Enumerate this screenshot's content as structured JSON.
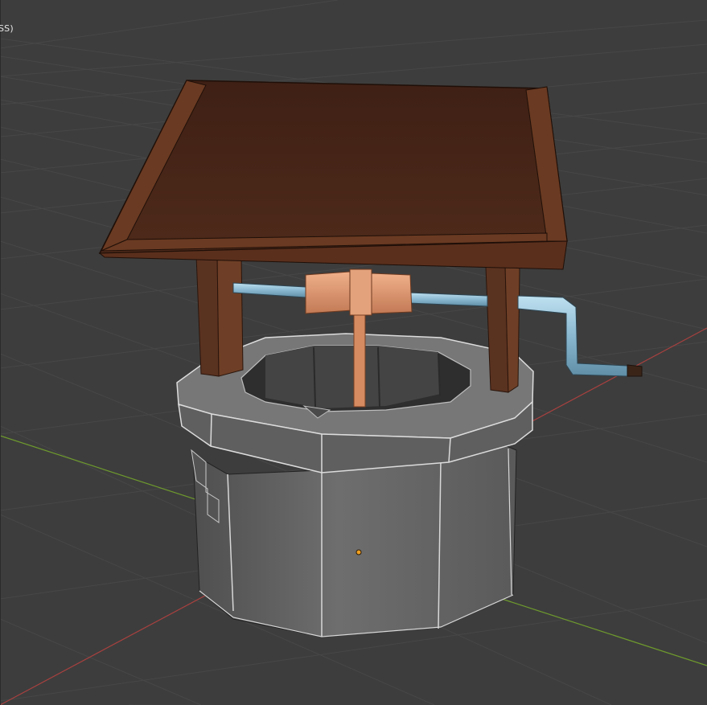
{
  "viewport": {
    "overlay_text": "SS)",
    "background_color": "#3d3d3d",
    "grid_color": "#4a4a4a",
    "x_axis_color": "#a8413f",
    "y_axis_color": "#6e9a2d",
    "origin_color": "#f0a020"
  },
  "model": {
    "roof_color": "#4a2618",
    "roof_edge_color": "#6a3a22",
    "post_color": "#5e3520",
    "stone_color": "#6b6b6b",
    "stone_edge_color": "#d0d0d0",
    "crank_color": "#8cbfd8",
    "spool_color": "#d9916a"
  }
}
